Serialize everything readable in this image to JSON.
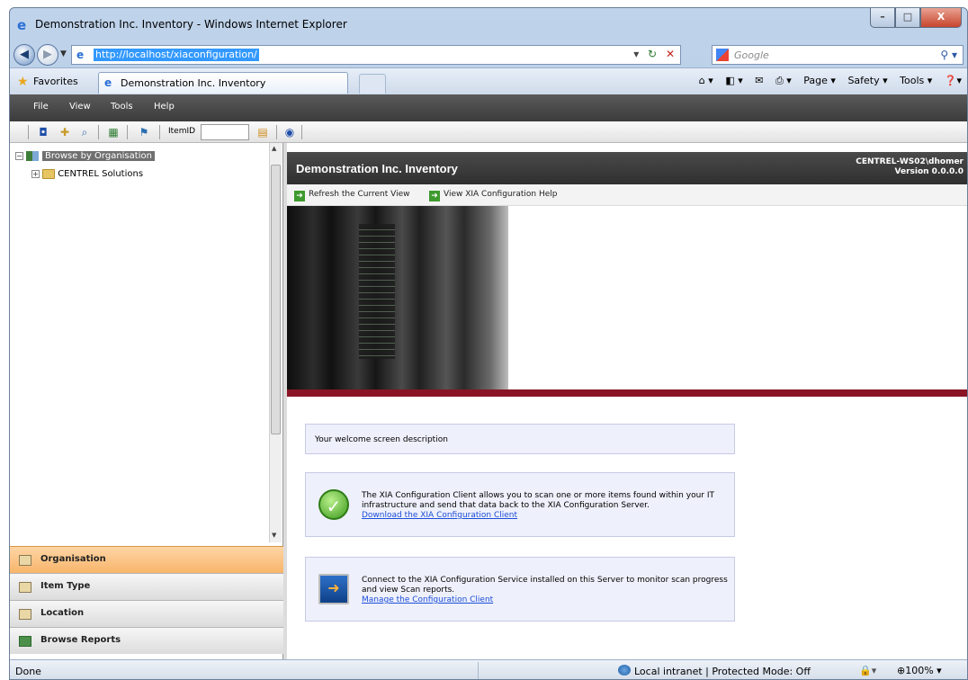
{
  "window": {
    "title": "Demonstration Inc. Inventory - Windows Internet Explorer",
    "controls": {
      "min": "–",
      "max": "□",
      "close": "X"
    }
  },
  "address": {
    "url": "http://localhost/xiaconfiguration/",
    "search_placeholder": "Google"
  },
  "favorites_bar": {
    "favorites_label": "Favorites",
    "tab_label": "Demonstration Inc. Inventory",
    "commands": [
      "Page ▾",
      "Safety ▾",
      "Tools ▾"
    ]
  },
  "menu": {
    "items": [
      "File",
      "View",
      "Tools",
      "Help"
    ]
  },
  "toolbar": {
    "itemid_label": "ItemID",
    "itemid_value": ""
  },
  "tree": {
    "root_label": "Browse by Organisation",
    "child_label": "CENTREL Solutions"
  },
  "accordion": {
    "items": [
      "Organisation",
      "Item Type",
      "Location",
      "Browse Reports"
    ],
    "active": "Organisation"
  },
  "main": {
    "header_title": "Demonstration Inc. Inventory",
    "user_line": "CENTREL-WS02\\dhomer",
    "version_line": "Version 0.0.0.0",
    "actions": [
      "Refresh the Current View",
      "View XIA Configuration Help"
    ],
    "welcome_text": "Your welcome screen description",
    "client_card": {
      "text": "The XIA Configuration Client allows you to scan one or more items found within your IT infrastructure and send that data back to the XIA Configuration Server.",
      "link": "Download the XIA Configuration Client"
    },
    "manage_card": {
      "text": "Connect to the XIA Configuration Service installed on this Server to monitor scan progress and view Scan reports.",
      "link": "Manage the Configuration Client"
    }
  },
  "status": {
    "left": "Done",
    "zone": "Local intranet | Protected Mode: Off",
    "zoom": "100%"
  },
  "colors": {
    "accent_red": "#8a1425",
    "active_tab": "#f7b56b",
    "header_dark": "#333333"
  }
}
